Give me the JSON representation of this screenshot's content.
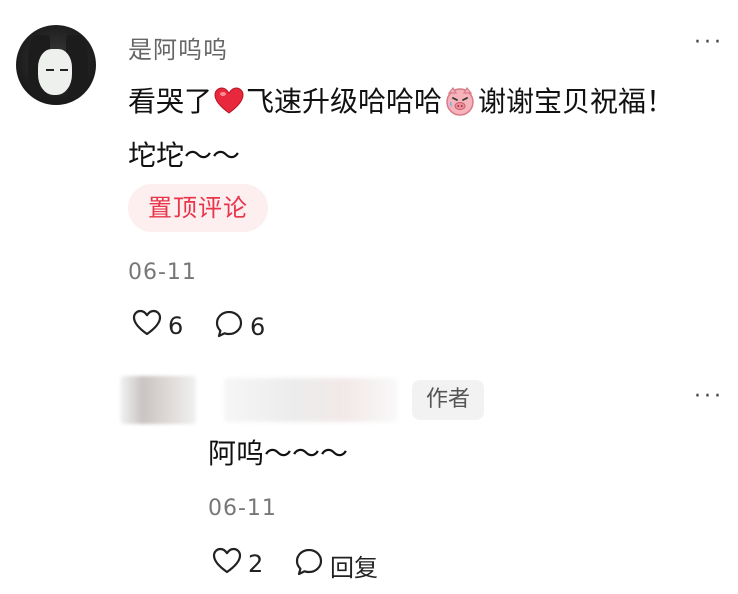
{
  "comment": {
    "username": "是阿呜呜",
    "more_label": "···",
    "text_part1": "看哭了",
    "text_part2": "飞速升级哈哈哈",
    "text_part3": "谢谢宝贝祝福！",
    "text_line2": "坨坨～～",
    "pin_tag": "置顶评论",
    "date": "06-11",
    "like_count": "6",
    "comment_count": "6",
    "icons": [
      "heart-emoji",
      "pig-emoji",
      "heart-outline-icon",
      "comment-bubble-icon",
      "more-icon"
    ],
    "colors": {
      "pin_tag_text": "#e8354a",
      "pin_tag_bg": "#fdeeef",
      "heart_emoji": "#e8283c"
    }
  },
  "reply": {
    "author_badge": "作者",
    "more_label": "···",
    "text": "阿呜～～～",
    "date": "06-11",
    "like_count": "2",
    "reply_label": "回复"
  }
}
